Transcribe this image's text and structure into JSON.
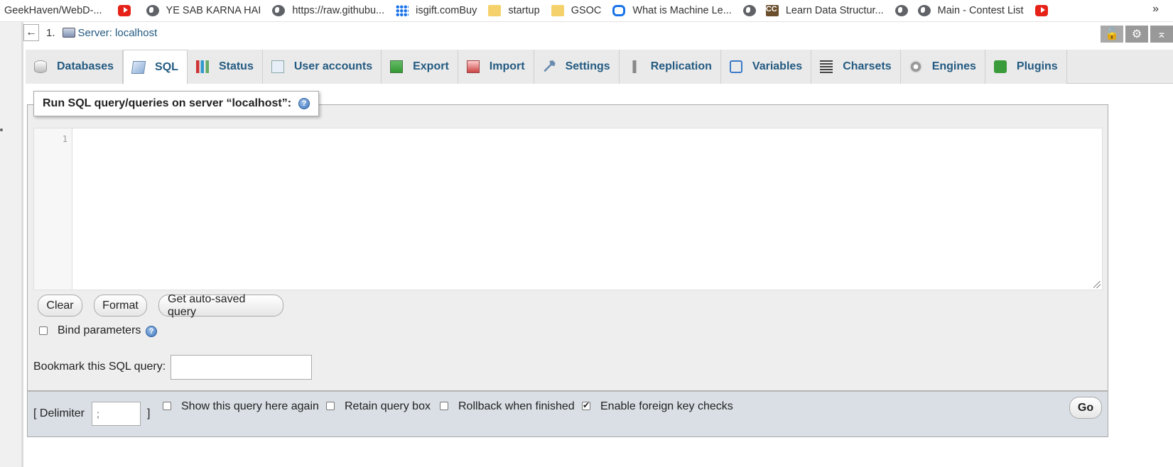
{
  "bookmarks": [
    {
      "label": "GeekHaven/WebD-...",
      "icon": "none"
    },
    {
      "label": "",
      "icon": "youtube-icon"
    },
    {
      "label": "YE SAB KARNA HAI",
      "icon": "globe-icon"
    },
    {
      "label": "https://raw.githubu...",
      "icon": "globe-icon"
    },
    {
      "label": "isgift.comBuy",
      "icon": "grid-icon"
    },
    {
      "label": "startup",
      "icon": "folder-icon"
    },
    {
      "label": "GSOC",
      "icon": "folder-icon"
    },
    {
      "label": "What is Machine Le...",
      "icon": "infinity-icon"
    },
    {
      "label": "",
      "icon": "globe-icon"
    },
    {
      "label": "Learn Data Structur...",
      "icon": "cc-icon"
    },
    {
      "label": "",
      "icon": "globe-icon"
    },
    {
      "label": "Main - Contest List",
      "icon": "globe-icon"
    },
    {
      "label": "",
      "icon": "youtube-icon"
    }
  ],
  "bookmarks_more": "»",
  "breadcrumb": {
    "back": "←",
    "number": "1.",
    "server_label": "Server: localhost"
  },
  "tabs": [
    {
      "label": "Databases",
      "icon": "database-icon",
      "active": false
    },
    {
      "label": "SQL",
      "icon": "sql-icon",
      "active": true
    },
    {
      "label": "Status",
      "icon": "status-icon",
      "active": false
    },
    {
      "label": "User accounts",
      "icon": "users-icon",
      "active": false
    },
    {
      "label": "Export",
      "icon": "export-icon",
      "active": false
    },
    {
      "label": "Import",
      "icon": "import-icon",
      "active": false
    },
    {
      "label": "Settings",
      "icon": "wrench-icon",
      "active": false
    },
    {
      "label": "Replication",
      "icon": "replication-icon",
      "active": false
    },
    {
      "label": "Variables",
      "icon": "variables-icon",
      "active": false
    },
    {
      "label": "Charsets",
      "icon": "charsets-icon",
      "active": false
    },
    {
      "label": "Engines",
      "icon": "engines-icon",
      "active": false
    },
    {
      "label": "Plugins",
      "icon": "plugin-icon",
      "active": false
    }
  ],
  "query": {
    "title": "Run SQL query/queries on server “localhost”:",
    "help": "?",
    "line_number": "1",
    "editor_value": "",
    "buttons": {
      "clear": "Clear",
      "format": "Format",
      "autosaved": "Get auto-saved query"
    },
    "bind_parameters": "Bind parameters",
    "bookmark_label": "Bookmark this SQL query:",
    "bookmark_value": ""
  },
  "footer": {
    "delimiter_open": "[ Delimiter",
    "delimiter_value": ";",
    "delimiter_close": "]",
    "show_again": "Show this query here again",
    "retain": "Retain query box",
    "rollback": "Rollback when finished",
    "foreign_keys": "Enable foreign key checks",
    "foreign_keys_checked": true,
    "go": "Go"
  },
  "colors": {
    "link": "#235a81",
    "footer_bg": "#d9dfe5",
    "panel_bg": "#eeeeee"
  }
}
